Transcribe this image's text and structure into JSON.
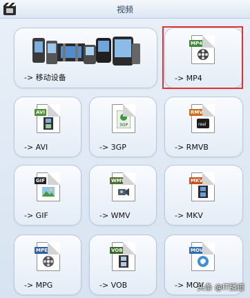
{
  "window": {
    "title": "视频"
  },
  "tiles": [
    {
      "label": "-> 移动设备",
      "icon": "mobile-devices-icon"
    },
    {
      "label": "-> MP4",
      "icon": "mp4-file-icon",
      "tag": "MP4",
      "tag_color": "#3f8a3a"
    },
    {
      "label": "-> AVI",
      "icon": "avi-file-icon",
      "tag": "AVI",
      "tag_color": "#4e8f2f"
    },
    {
      "label": "-> 3GP",
      "icon": "3gp-file-icon",
      "tag": "3GP",
      "tag_color": "#3c9b3e"
    },
    {
      "label": "-> RMVB",
      "icon": "rmvb-file-icon",
      "tag": "RMVB",
      "tag_color": "#d16a1c"
    },
    {
      "label": "-> GIF",
      "icon": "gif-file-icon",
      "tag": "GIF",
      "tag_color": "#222222"
    },
    {
      "label": "-> WMV",
      "icon": "wmv-file-icon",
      "tag": "WMV",
      "tag_color": "#4c6f2e"
    },
    {
      "label": "-> MKV",
      "icon": "mkv-file-icon",
      "tag": "MKV",
      "tag_color": "#c9521f"
    },
    {
      "label": "-> MPG",
      "icon": "mpg-file-icon",
      "tag": "MPEG",
      "tag_color": "#2f5fa8"
    },
    {
      "label": "-> VOB",
      "icon": "vob-file-icon",
      "tag": "VOB",
      "tag_color": "#3a6d2a"
    },
    {
      "label": "-> MOV",
      "icon": "mov-file-icon",
      "tag": "MOV",
      "tag_color": "#2e6fb8"
    }
  ],
  "watermark": "头条 @IT播道",
  "highlight_color": "#e0322e"
}
